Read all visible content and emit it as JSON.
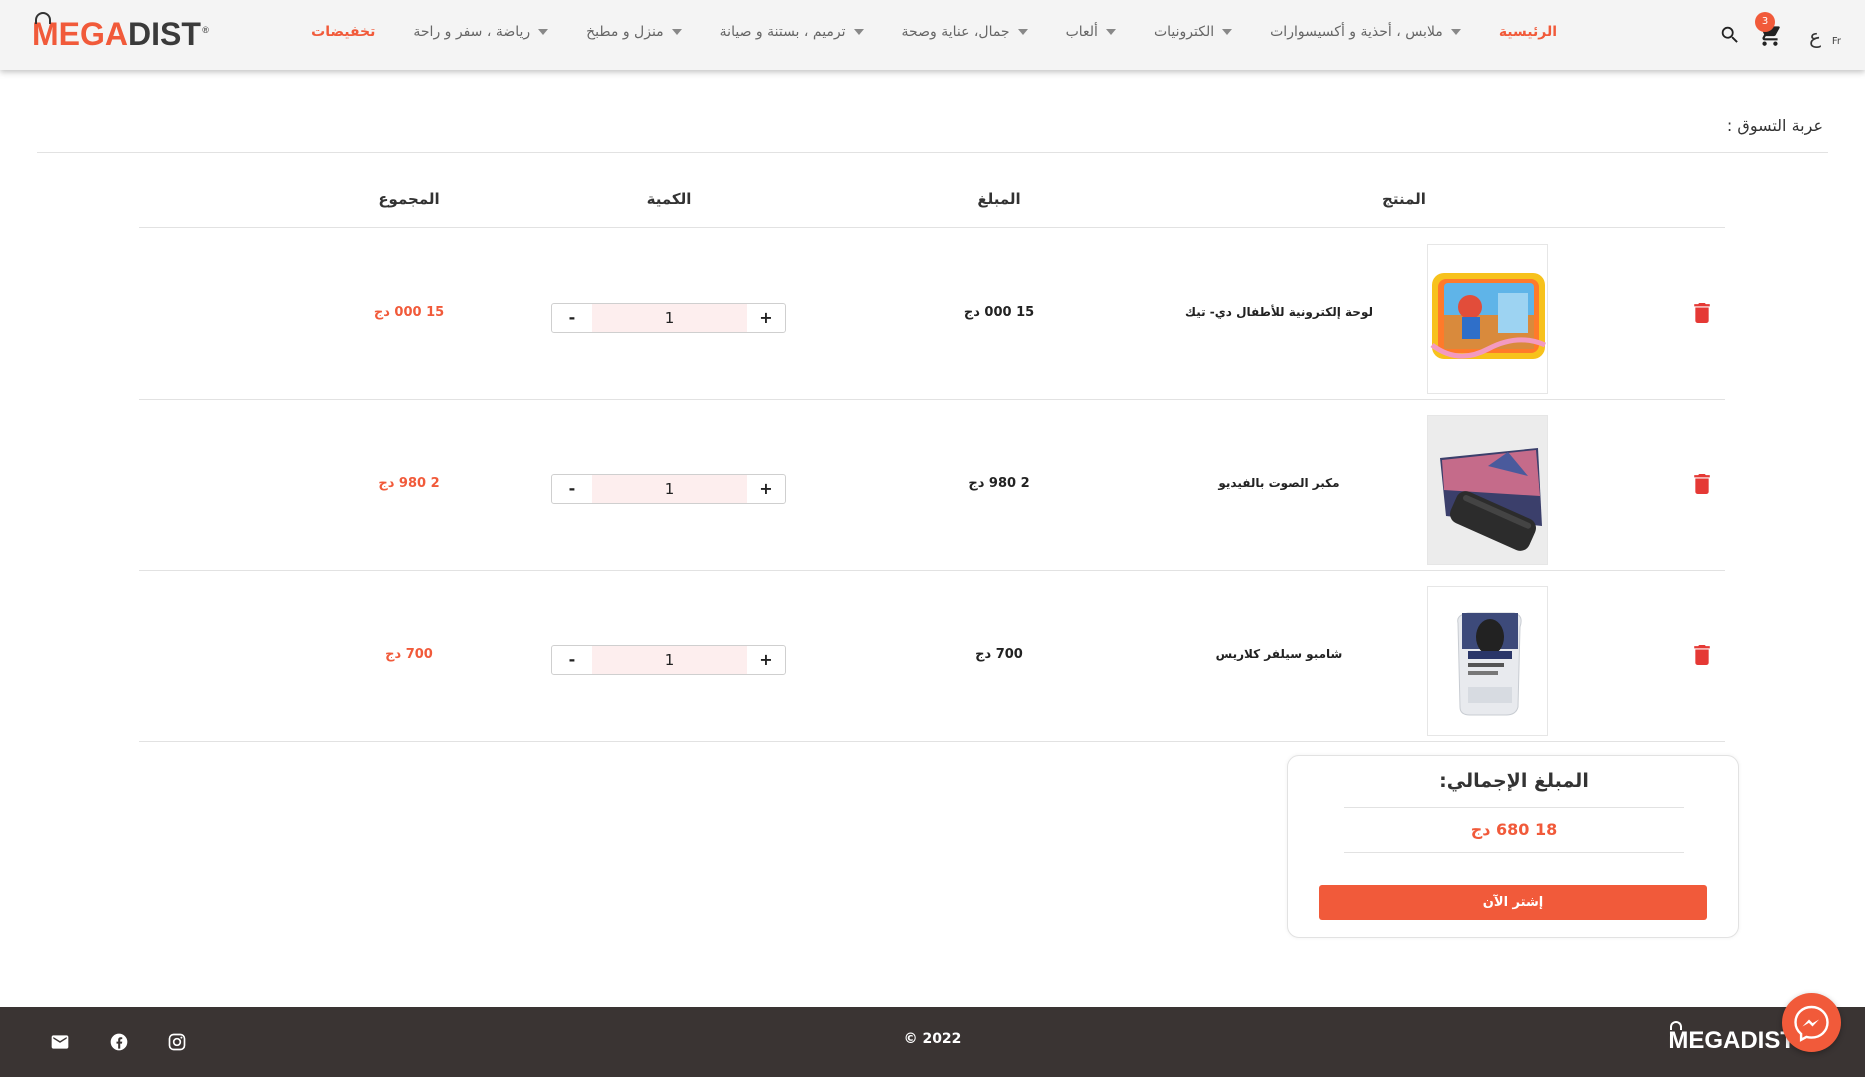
{
  "brand": {
    "logo_mega": "MEGA",
    "logo_dist": "DIST",
    "registered": "®",
    "accent": "#f15a3a"
  },
  "nav": {
    "home": "الرئيسية",
    "clothing": "ملابس ، أحذية و أكسيسوارات",
    "electronics": "الكترونيات",
    "games": "ألعاب",
    "beauty": "جمال، عناية وصحة",
    "diy": "ترميم ، بستنة و صيانة",
    "home_kitchen": "منزل و مطبخ",
    "sports": "رياضة ، سفر و راحة",
    "sale": "تخفيضات"
  },
  "header": {
    "cart_count": "3",
    "lang_ar": "ع",
    "lang_fr": "Fr"
  },
  "page": {
    "title": "عربة التسوق :"
  },
  "table": {
    "col_product": "المنتج",
    "col_price": "المبلغ",
    "col_qty": "الكمية",
    "col_total": "المجموع"
  },
  "items": [
    {
      "name": "لوحة إلكترونية للأطفال دي- تيك",
      "price": "15 000 دج",
      "qty": "1",
      "total": "15 000 دج",
      "image": "kids-tablet"
    },
    {
      "name": "مكبر الصوت بالفيديو",
      "price": "2 980 دج",
      "qty": "1",
      "total": "2 980 دج",
      "image": "video-speaker"
    },
    {
      "name": "شامبو سيلفر كلاريس",
      "price": "700 دج",
      "qty": "1",
      "total": "700 دج",
      "image": "silver-shampoo"
    }
  ],
  "qty_controls": {
    "minus": "-",
    "plus": "+"
  },
  "summary": {
    "title": "المبلغ  الإجمالي:",
    "amount": "18 680 دج",
    "buy_label": "إشتر الآن"
  },
  "footer": {
    "copyright": "© 2022",
    "logo": "MEGADIST"
  }
}
